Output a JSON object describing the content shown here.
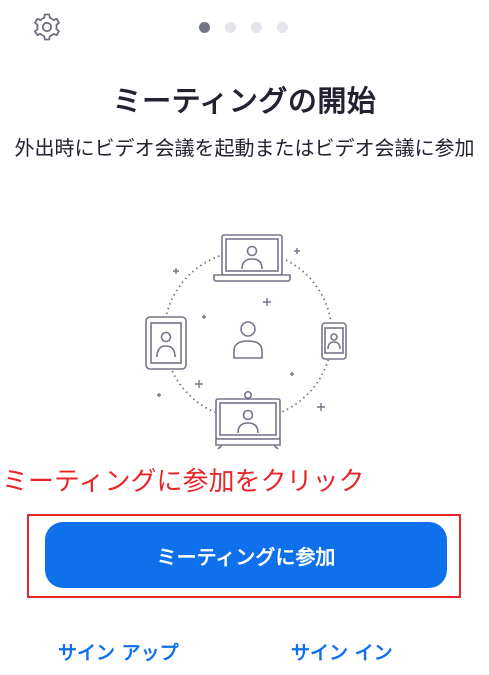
{
  "header": {
    "settings_icon": "gear-icon",
    "page_indicator": {
      "count": 4,
      "active_index": 0
    }
  },
  "main": {
    "title": "ミーティングの開始",
    "subtitle": "外出時にビデオ会議を起動またはビデオ会議に参加",
    "illustration_icons": [
      "laptop-icon",
      "tablet-icon",
      "phone-icon",
      "conference-room-icon",
      "person-icon"
    ]
  },
  "annotation": {
    "text": "ミーティングに参加をクリック",
    "color": "#e8262a"
  },
  "actions": {
    "join_label": "ミーティングに参加",
    "signup_label": "サイン アップ",
    "signin_label": "サイン イン"
  },
  "colors": {
    "primary": "#0e71eb",
    "highlight": "#e8262a",
    "text": "#222230"
  }
}
